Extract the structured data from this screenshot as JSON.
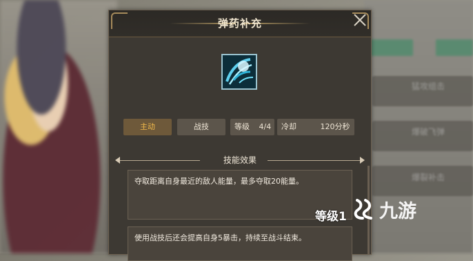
{
  "dialog": {
    "title": "弹药补充",
    "close_icon": "close-icon"
  },
  "skill": {
    "icon": "ammo-refill-skill-icon",
    "type_tag": "主动",
    "category_tag": "战技",
    "level_label": "等级",
    "level_value": "4/4",
    "cooldown_label": "冷却",
    "cooldown_value": "120分秒"
  },
  "effects": {
    "section_title": "技能效果",
    "items": [
      "夺取距离自身最近的敌人能量，最多夺取20能量。",
      "使用战技后还会提高自身5暴击，持续至战斗结束。"
    ]
  },
  "overlay": {
    "level_text": "等级1",
    "watermark": "九游"
  },
  "background": {
    "side_labels": [
      "猛攻组击",
      "爆破飞弹",
      "爆裂补击",
      "……"
    ]
  },
  "colors": {
    "accent": "#f0b94b",
    "panel_bg": "#3d3933",
    "chip_bg": "#5c554b"
  }
}
